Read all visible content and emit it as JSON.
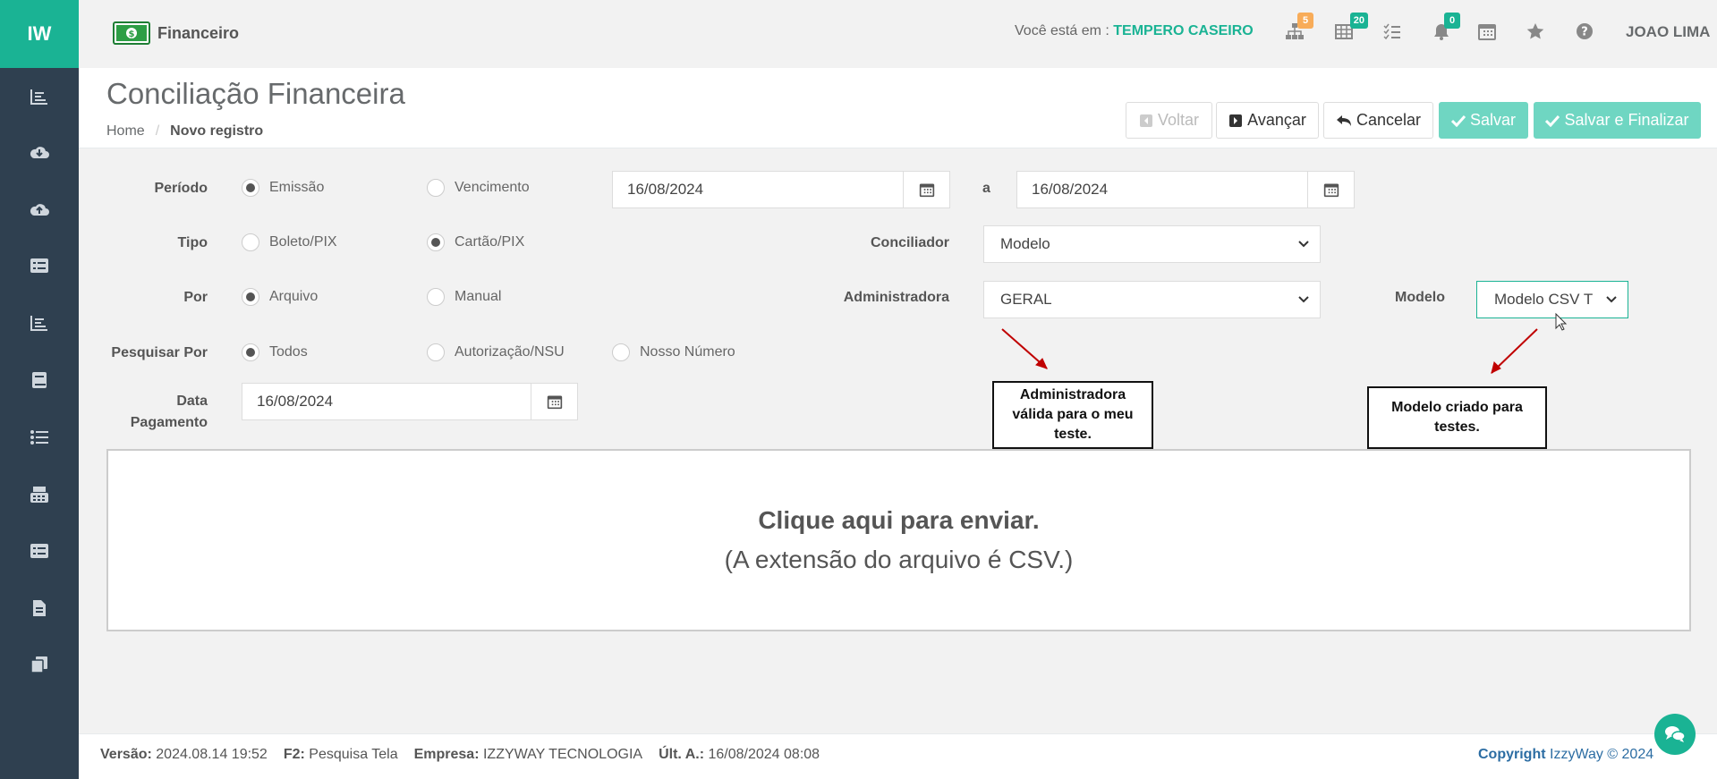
{
  "sidebar": {
    "logo": "IW",
    "icons": [
      "bar-chart-icon",
      "cloud-download-icon",
      "cloud-upload-icon",
      "list-alt-icon",
      "bar-chart-icon",
      "book-icon",
      "list-icon",
      "calculator-icon",
      "list-alt-icon",
      "file-icon",
      "copy-icon"
    ]
  },
  "topbar": {
    "module": "Financeiro",
    "where_label": "Você está em : ",
    "company": "TEMPERO CASEIRO",
    "badges": {
      "sitemap": "5",
      "table": "20",
      "bell": "0"
    },
    "user": "JOAO LIMA",
    "colors": {
      "accent": "#1ab394",
      "warning": "#f8ac59",
      "sidebar": "#2f4050"
    }
  },
  "header": {
    "title": "Conciliação Financeira",
    "breadcrumb_home": "Home",
    "breadcrumb_sep": "/",
    "breadcrumb_current": "Novo registro",
    "buttons": {
      "back": "Voltar",
      "next": "Avançar",
      "cancel": "Cancelar",
      "save": "Salvar",
      "save_finish": "Salvar e Finalizar"
    }
  },
  "form": {
    "periodo": {
      "label": "Período",
      "opt1": "Emissão",
      "opt2": "Vencimento",
      "date_from": "16/08/2024",
      "to": "a",
      "date_to": "16/08/2024"
    },
    "tipo": {
      "label": "Tipo",
      "opt1": "Boleto/PIX",
      "opt2": "Cartão/PIX"
    },
    "conciliador": {
      "label": "Conciliador",
      "value": "Modelo"
    },
    "por": {
      "label": "Por",
      "opt1": "Arquivo",
      "opt2": "Manual"
    },
    "administradora": {
      "label": "Administradora",
      "value": "GERAL"
    },
    "modelo": {
      "label": "Modelo",
      "value": "Modelo CSV T"
    },
    "pesquisar": {
      "label": "Pesquisar Por",
      "opt1": "Todos",
      "opt2": "Autorização/NSU",
      "opt3": "Nosso Número"
    },
    "data_pagamento": {
      "label1": "Data",
      "label2": "Pagamento",
      "value": "16/08/2024"
    }
  },
  "annotations": {
    "admin_note": [
      "Administradora",
      "válida para o meu",
      "teste."
    ],
    "modelo_note": [
      "Modelo criado para",
      "testes."
    ]
  },
  "dropzone": {
    "line1": "Clique aqui para enviar.",
    "line2": "(A extensão do arquivo é CSV.)"
  },
  "footer": {
    "versao_label": "Versão:",
    "versao": "2024.08.14 19:52",
    "f2_label": "F2:",
    "f2": "Pesquisa Tela",
    "empresa_label": "Empresa:",
    "empresa": "IZZYWAY TECNOLOGIA",
    "ult_label": "Últ. A.:",
    "ult": "16/08/2024 08:08",
    "copyright_label": "Copyright",
    "copyright": "IzzyWay © 2024"
  }
}
